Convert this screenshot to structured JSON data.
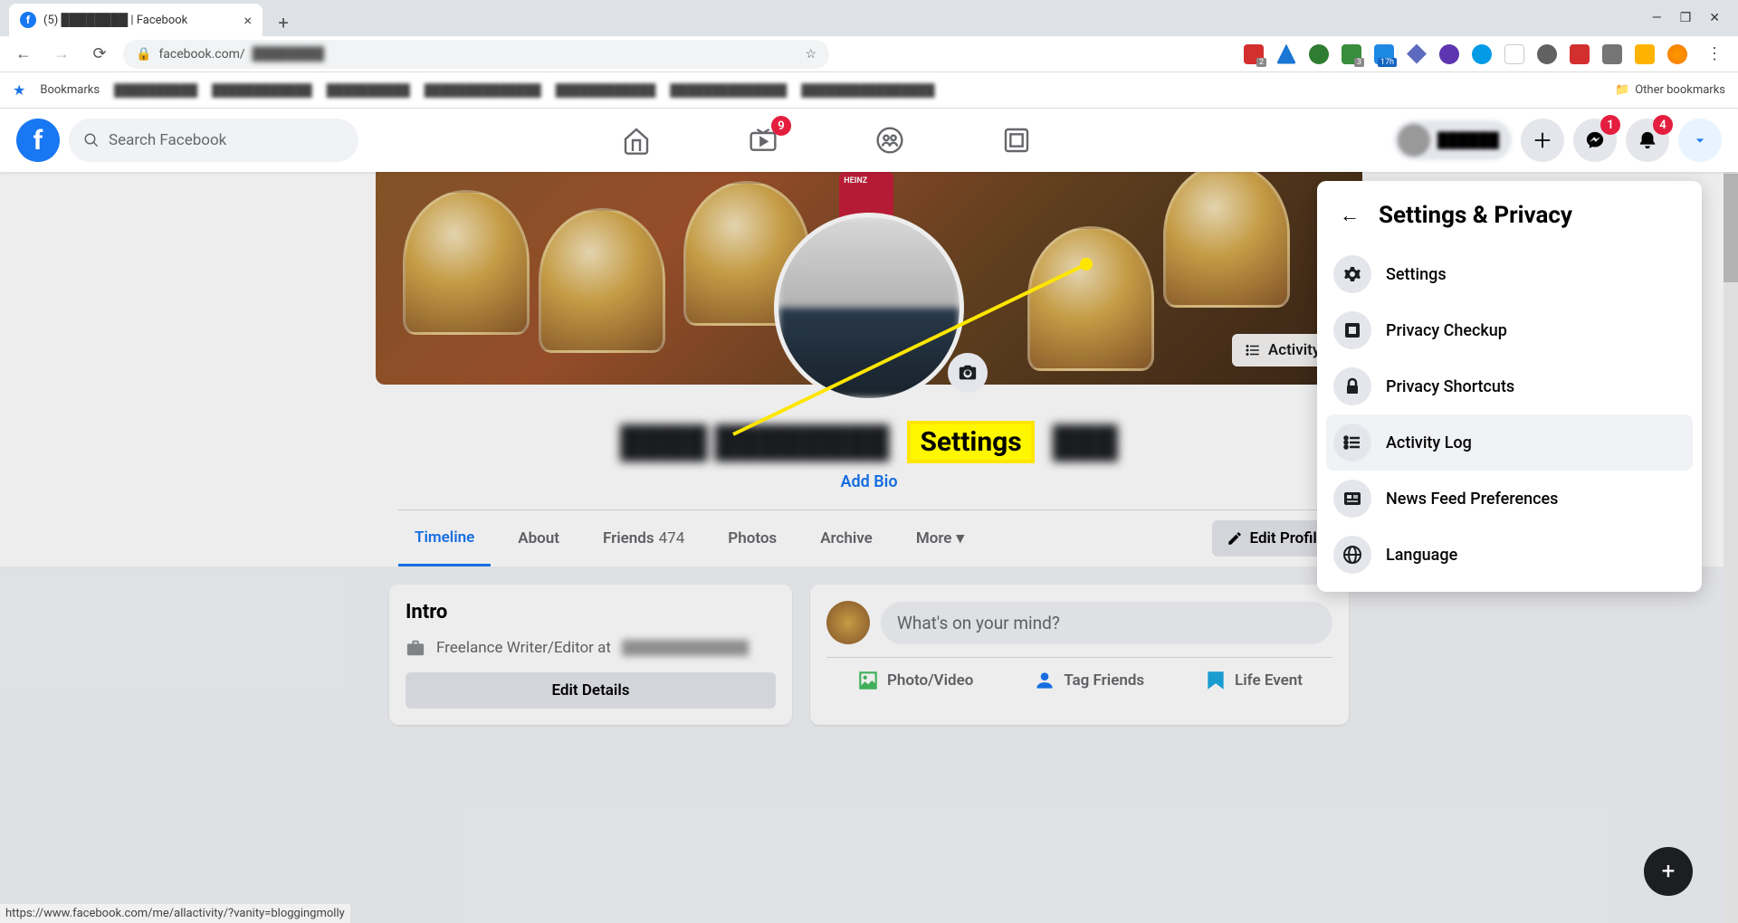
{
  "browser": {
    "tab_title": "(5) ████████ | Facebook",
    "url_prefix": "facebook.com/",
    "url_blur": "████████",
    "bookmarks_label": "Bookmarks",
    "other_bookmarks": "Other bookmarks",
    "status_url": "https://www.facebook.com/me/allactivity/?vanity=bloggingmolly"
  },
  "fb_header": {
    "search_placeholder": "Search Facebook",
    "watch_badge": "9",
    "messenger_badge": "1",
    "notif_badge": "4"
  },
  "profile": {
    "activity_log_btn": "Activity Log",
    "name_blur": "████ ████████",
    "add_bio": "Add Bio",
    "tabs": {
      "timeline": "Timeline",
      "about": "About",
      "friends": "Friends",
      "friends_count": "474",
      "photos": "Photos",
      "archive": "Archive",
      "more": "More"
    },
    "edit_profile": "Edit Profile"
  },
  "intro": {
    "title": "Intro",
    "job": "Freelance Writer/Editor at",
    "edit_details": "Edit Details"
  },
  "composer": {
    "placeholder": "What's on your mind?",
    "photo": "Photo/Video",
    "tag": "Tag Friends",
    "life": "Life Event"
  },
  "dropdown": {
    "title": "Settings & Privacy",
    "items": [
      {
        "label": "Settings",
        "icon": "gear"
      },
      {
        "label": "Privacy Checkup",
        "icon": "shield"
      },
      {
        "label": "Privacy Shortcuts",
        "icon": "lock"
      },
      {
        "label": "Activity Log",
        "icon": "list"
      },
      {
        "label": "News Feed Preferences",
        "icon": "news"
      },
      {
        "label": "Language",
        "icon": "globe"
      }
    ]
  },
  "annotation": {
    "highlight_text": "Settings"
  }
}
